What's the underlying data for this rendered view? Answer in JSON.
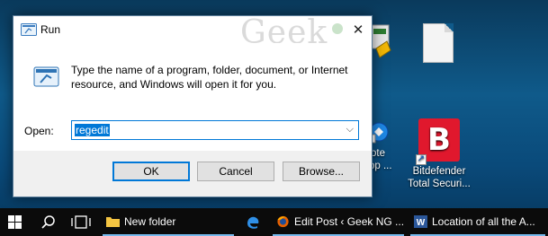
{
  "desktop": {
    "icons": [
      {
        "label": "",
        "icon": "document-icon"
      },
      {
        "label": "",
        "icon": "remote-desktop-icon"
      },
      {
        "label": "Bitdefender Total Securi...",
        "icon": "bitdefender-icon",
        "glyph": "B"
      }
    ],
    "partial_labels": [
      "ote",
      "op ..."
    ],
    "accent_colors": {
      "bitdefender": "#e0182d",
      "selection": "#0078d7",
      "taskbar": "#0b0b0b"
    }
  },
  "run_dialog": {
    "title": "Run",
    "close_glyph": "✕",
    "description": "Type the name of a program, folder, document, or Internet resource, and Windows will open it for you.",
    "open_label": "Open:",
    "open_value": "regedit",
    "dropdown_glyph": "⌵",
    "buttons": {
      "ok": "OK",
      "cancel": "Cancel",
      "browse": "Browse..."
    },
    "watermark": "Geek"
  },
  "taskbar": {
    "items": [
      {
        "label": "New folder",
        "icon": "folder-icon"
      },
      {
        "label": "",
        "icon": "edge-icon"
      },
      {
        "label": "Edit Post ‹ Geek NG ...",
        "icon": "firefox-icon"
      },
      {
        "label": "Location of all the A...",
        "icon": "word-icon"
      }
    ]
  }
}
